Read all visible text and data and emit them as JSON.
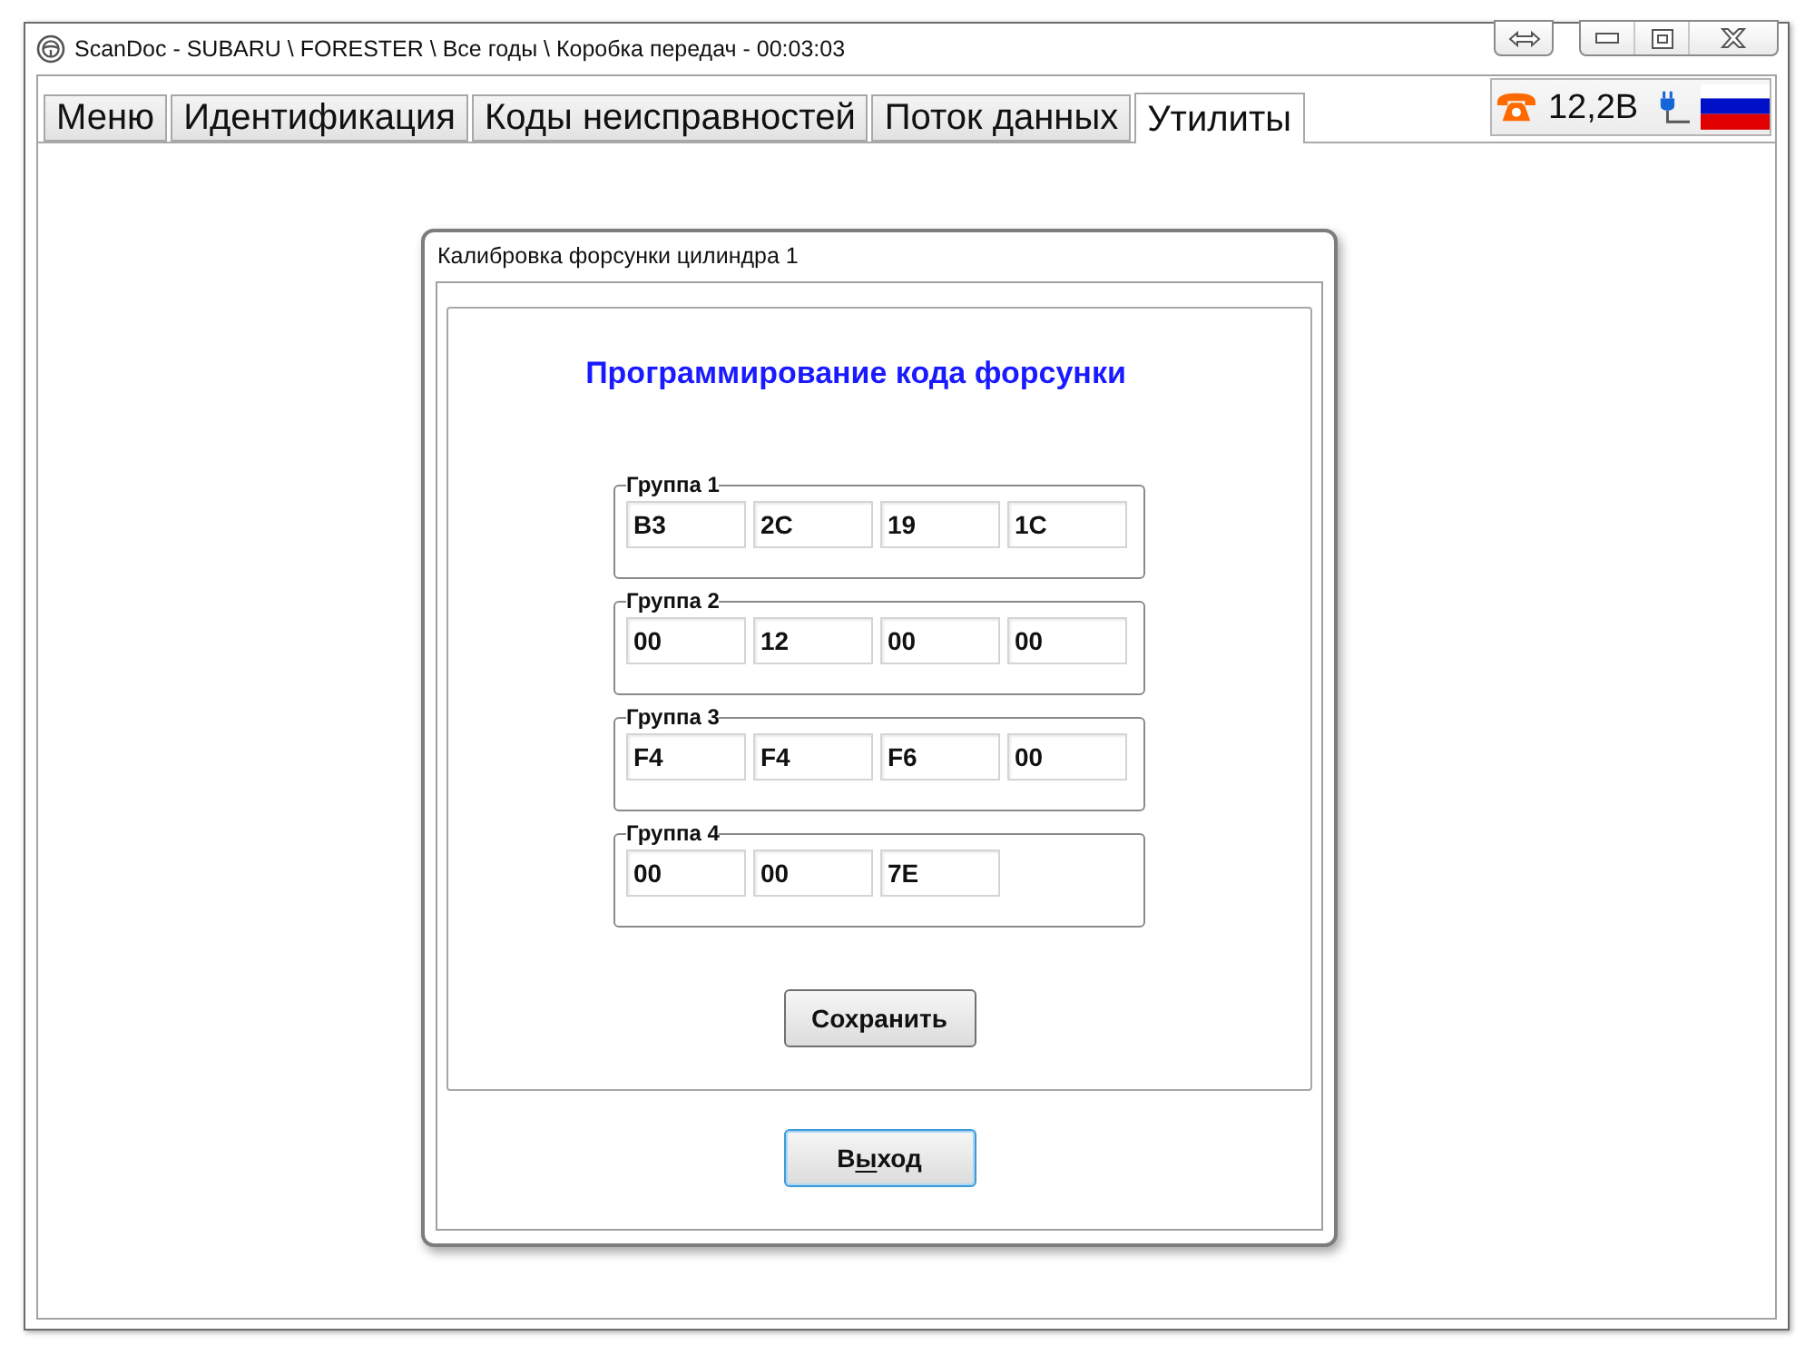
{
  "window": {
    "title": "ScanDoc - SUBARU \\ FORESTER \\ Все годы \\ Коробка передач - 00:03:03"
  },
  "tabs": [
    {
      "label": "Меню",
      "selected": false
    },
    {
      "label": "Идентификация",
      "selected": false
    },
    {
      "label": "Коды неисправностей",
      "selected": false
    },
    {
      "label": "Поток данных",
      "selected": false
    },
    {
      "label": "Утилиты",
      "selected": true
    }
  ],
  "status": {
    "voltage": "12,2В"
  },
  "dialog": {
    "title": "Калибровка форсунки цилиндра 1",
    "heading": "Программирование кода форсунки",
    "groups": [
      {
        "label": "Группа 1",
        "fields": [
          "B3",
          "2C",
          "19",
          "1C"
        ]
      },
      {
        "label": "Группа 2",
        "fields": [
          "00",
          "12",
          "00",
          "00"
        ]
      },
      {
        "label": "Группа 3",
        "fields": [
          "F4",
          "F4",
          "F6",
          "00"
        ]
      },
      {
        "label": "Группа 4",
        "fields": [
          "00",
          "00",
          "7E"
        ]
      }
    ],
    "save_button": {
      "label_parts": [
        {
          "text": "Сохранить",
          "underline": false
        }
      ],
      "focused": false
    },
    "exit_button": {
      "label_parts": [
        {
          "text": "В",
          "underline": false
        },
        {
          "text": "ы",
          "underline": true
        },
        {
          "text": "ход",
          "underline": false
        }
      ],
      "focused": true
    }
  }
}
